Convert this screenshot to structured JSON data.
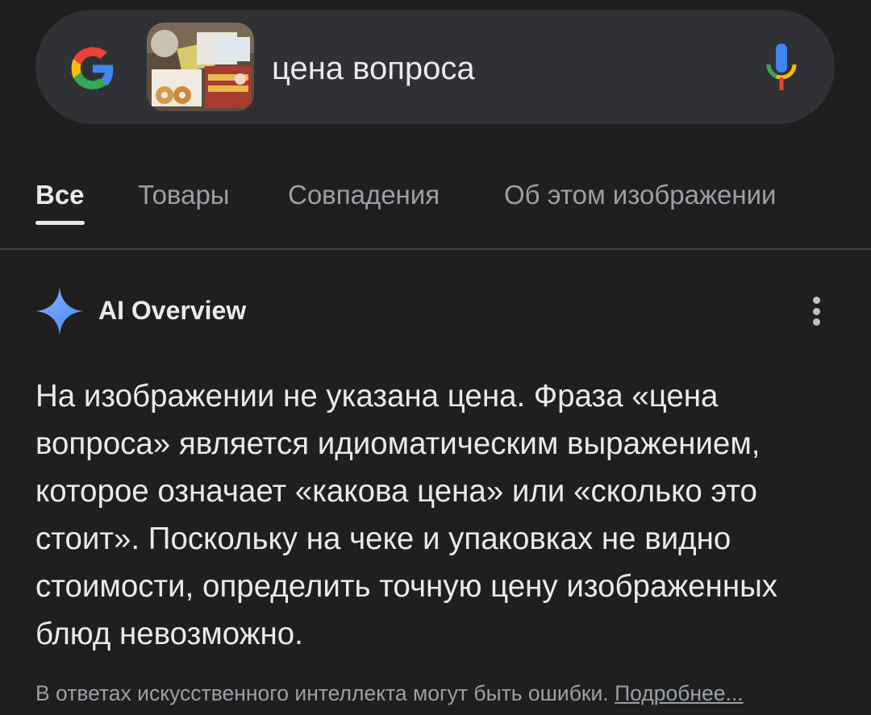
{
  "search": {
    "query": "цена вопроса"
  },
  "tabs": [
    {
      "label": "Все",
      "active": true
    },
    {
      "label": "Товары",
      "active": false
    },
    {
      "label": "Совпадения",
      "active": false
    },
    {
      "label": "Об этом изображении",
      "active": false
    }
  ],
  "ai_overview": {
    "title": "AI Overview",
    "body": "На изображении не указана цена. Фраза «цена вопроса» является идиоматическим выражением, которое означает «какова цена» или «сколько это стоит». Поскольку на чеке и упаковках не видно стоимости, определить точную цену изображенных блюд невозможно.",
    "disclaimer": "В ответах искусственного интеллекта могут быть ошибки.",
    "more_link": "Подробнее..."
  },
  "colors": {
    "background": "#1f1f1f",
    "search_bar": "#303134",
    "text_primary": "#e8eaed",
    "text_secondary": "#9aa0a6",
    "ai_sparkle": "#8ab4f8"
  },
  "icons": [
    "google-g-icon",
    "image-thumbnail",
    "mic-icon",
    "ai-sparkle-icon",
    "more-vert-icon"
  ]
}
